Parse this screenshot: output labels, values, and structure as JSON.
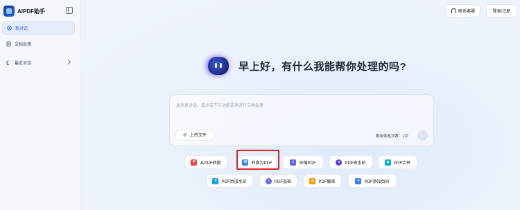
{
  "app": {
    "name": "AIPDF助手"
  },
  "sidebar": {
    "items": [
      {
        "label": "新对话",
        "icon": "new-chat-icon"
      },
      {
        "label": "文档处理",
        "icon": "document-icon"
      },
      {
        "label": "最近对话",
        "icon": "chat-bubble-icon"
      }
    ]
  },
  "header": {
    "contact_label": "联系客服",
    "login_label": "登录/注册"
  },
  "greeting": {
    "text": "早上好，有什么我能帮你处理的吗?"
  },
  "chat": {
    "placeholder": "发消息对话，或点击下方功能选项进行文档处理",
    "upload_label": "上传文件",
    "remaining_text": "剩余体验次数：2次",
    "send_icon": "arrow-up-icon"
  },
  "tools": [
    {
      "label": "从PDF转换",
      "icon": "pdf-convert-icon",
      "color": "#ef4444"
    },
    {
      "label": "转换为PDF",
      "icon": "to-pdf-icon",
      "color": "#3b82f6",
      "highlighted": true
    },
    {
      "label": "压缩PDF",
      "icon": "compress-icon",
      "color": "#6366f1"
    },
    {
      "label": "PDF去水印",
      "icon": "remove-watermark-icon",
      "color": "#4f46e5"
    },
    {
      "label": "PDF合并",
      "icon": "merge-icon",
      "color": "#06b6d4"
    },
    {
      "label": "PDF添加水印",
      "icon": "add-watermark-icon",
      "color": "#0ea5e9"
    },
    {
      "label": "PDF加密",
      "icon": "encrypt-icon",
      "color": "#6366f1"
    },
    {
      "label": "PDF解密",
      "icon": "decrypt-icon",
      "color": "#f59e0b"
    },
    {
      "label": "PDF添加页码",
      "icon": "page-number-icon",
      "color": "#3b82f6"
    }
  ],
  "colors": {
    "accent": "#2563eb",
    "highlight_border": "#dc2626"
  }
}
